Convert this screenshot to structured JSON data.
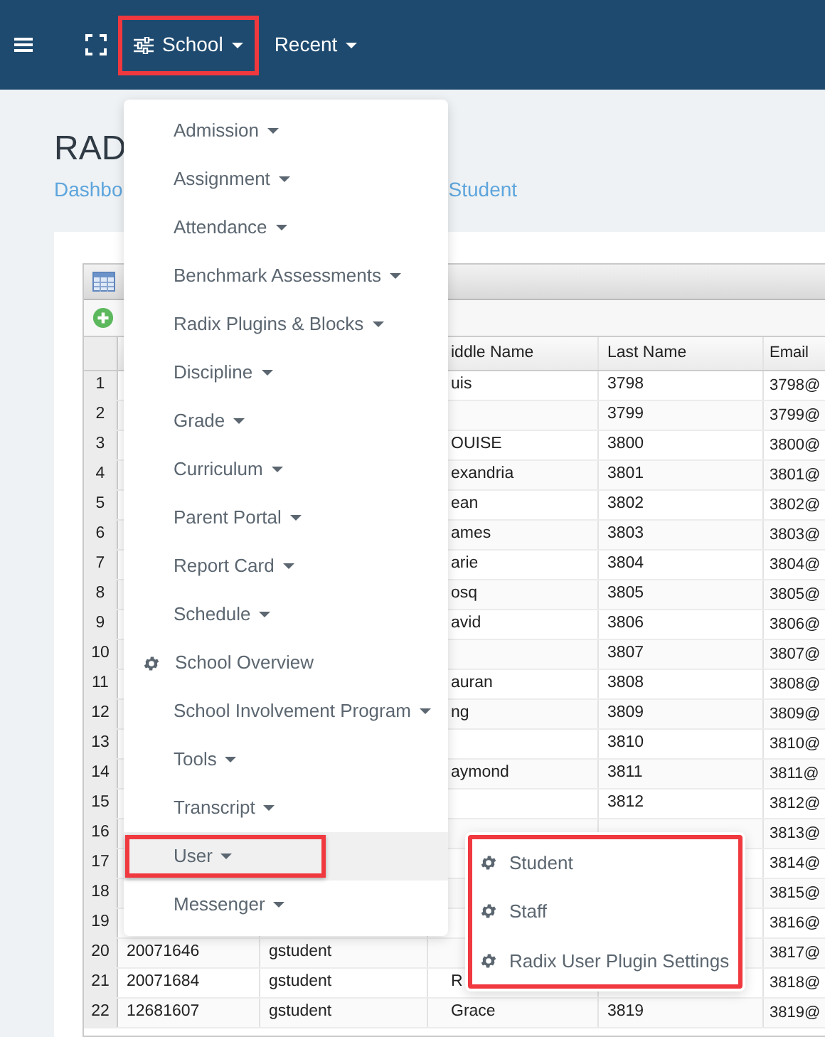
{
  "navbar": {
    "menus": [
      {
        "label": "School",
        "highlighted": true
      },
      {
        "label": "Recent",
        "highlighted": false
      }
    ]
  },
  "page_title": "RAD",
  "breadcrumb": [
    "Dashbo",
    "Student"
  ],
  "dropdown": {
    "items": [
      {
        "label": "Admission",
        "kind": "submenu",
        "selected": false,
        "highlighted": false
      },
      {
        "label": "Assignment",
        "kind": "submenu",
        "selected": false,
        "highlighted": false
      },
      {
        "label": "Attendance",
        "kind": "submenu",
        "selected": false,
        "highlighted": false
      },
      {
        "label": "Benchmark Assessments",
        "kind": "submenu",
        "selected": false,
        "highlighted": false
      },
      {
        "label": "Radix Plugins & Blocks",
        "kind": "submenu",
        "selected": false,
        "highlighted": false
      },
      {
        "label": "Discipline",
        "kind": "submenu",
        "selected": false,
        "highlighted": false
      },
      {
        "label": "Grade",
        "kind": "submenu",
        "selected": false,
        "highlighted": false
      },
      {
        "label": "Curriculum",
        "kind": "submenu",
        "selected": false,
        "highlighted": false
      },
      {
        "label": "Parent Portal",
        "kind": "submenu",
        "selected": false,
        "highlighted": false
      },
      {
        "label": "Report Card",
        "kind": "submenu",
        "selected": false,
        "highlighted": false
      },
      {
        "label": "Schedule",
        "kind": "submenu",
        "selected": false,
        "highlighted": false
      },
      {
        "label": "School Overview",
        "kind": "page",
        "selected": false,
        "highlighted": false
      },
      {
        "label": "School Involvement Program",
        "kind": "submenu",
        "selected": false,
        "highlighted": false
      },
      {
        "label": "Tools",
        "kind": "submenu",
        "selected": false,
        "highlighted": false
      },
      {
        "label": "Transcript",
        "kind": "submenu",
        "selected": false,
        "highlighted": false
      },
      {
        "label": "User",
        "kind": "submenu",
        "selected": true,
        "highlighted": true
      },
      {
        "label": "Messenger",
        "kind": "submenu",
        "selected": false,
        "highlighted": false
      }
    ]
  },
  "submenu": {
    "highlighted": true,
    "items": [
      {
        "label": "Student"
      },
      {
        "label": "Staff"
      },
      {
        "label": "Radix User Plugin Settings"
      }
    ]
  },
  "grid": {
    "columns": [
      "iddle Name",
      "Last Name",
      "Email"
    ],
    "rows": [
      {
        "number": "1",
        "middle_name": "uis",
        "last_name": "3798",
        "email": "3798@"
      },
      {
        "number": "2",
        "last_name": "3799",
        "email": "3799@"
      },
      {
        "number": "3",
        "middle_name": "OUISE",
        "last_name": "3800",
        "email": "3800@"
      },
      {
        "number": "4",
        "middle_name": "exandria",
        "last_name": "3801",
        "email": "3801@"
      },
      {
        "number": "5",
        "middle_name": "ean",
        "last_name": "3802",
        "email": "3802@"
      },
      {
        "number": "6",
        "middle_name": "ames",
        "last_name": "3803",
        "email": "3803@"
      },
      {
        "number": "7",
        "middle_name": "arie",
        "last_name": "3804",
        "email": "3804@"
      },
      {
        "number": "8",
        "middle_name": "osq",
        "last_name": "3805",
        "email": "3805@"
      },
      {
        "number": "9",
        "middle_name": "avid",
        "last_name": "3806",
        "email": "3806@"
      },
      {
        "number": "10",
        "last_name": "3807",
        "email": "3807@"
      },
      {
        "number": "11",
        "middle_name": "auran",
        "last_name": "3808",
        "email": "3808@"
      },
      {
        "number": "12",
        "middle_name": "ng",
        "last_name": "3809",
        "email": "3809@"
      },
      {
        "number": "13",
        "last_name": "3810",
        "email": "3810@"
      },
      {
        "number": "14",
        "middle_name": "aymond",
        "last_name": "3811",
        "email": "3811@"
      },
      {
        "number": "15",
        "last_name": "3812",
        "email": "3812@"
      },
      {
        "number": "16",
        "email": "3813@"
      },
      {
        "number": "17",
        "email": "3814@"
      },
      {
        "number": "18",
        "email": "3815@"
      },
      {
        "number": "19",
        "email": "3816@"
      },
      {
        "number": "20",
        "id": "20071646",
        "username": "gstudent",
        "email": "3817@"
      },
      {
        "number": "21",
        "id": "20071684",
        "username": "gstudent",
        "middle_name": "R",
        "email": "3818@"
      },
      {
        "number": "22",
        "id": "12681607",
        "username": "gstudent",
        "middle_name": "Grace",
        "last_name": "3819",
        "email": "3819@"
      }
    ]
  }
}
